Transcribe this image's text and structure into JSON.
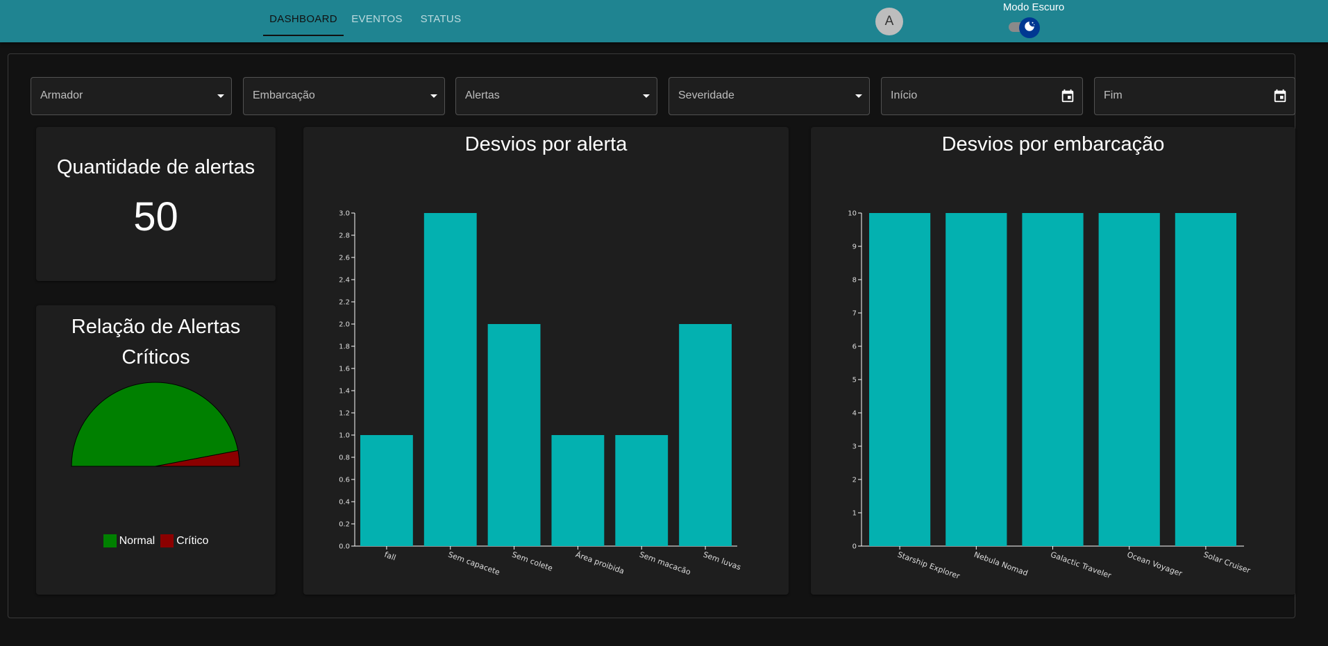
{
  "header": {
    "tabs": [
      {
        "label": "DASHBOARD",
        "active": true
      },
      {
        "label": "EVENTOS",
        "active": false
      },
      {
        "label": "STATUS",
        "active": false
      }
    ],
    "avatar_initial": "A",
    "dark_mode_label": "Modo Escuro",
    "dark_mode_on": true,
    "accent_color": "#1f8491"
  },
  "filters": [
    {
      "label": "Armador",
      "icon": "caret-down-icon"
    },
    {
      "label": "Embarcação",
      "icon": "caret-down-icon"
    },
    {
      "label": "Alertas",
      "icon": "caret-down-icon"
    },
    {
      "label": "Severidade",
      "icon": "caret-down-icon"
    },
    {
      "label": "Início",
      "icon": "calendar-icon"
    },
    {
      "label": "Fim",
      "icon": "calendar-icon"
    }
  ],
  "alert_count": {
    "title": "Quantidade de alertas",
    "value": "50"
  },
  "critical": {
    "title_line1": "Relação de Alertas",
    "title_line2": "Críticos",
    "legend": [
      {
        "label": "Normal",
        "color": "#008000"
      },
      {
        "label": "Crítico",
        "color": "#8b0000"
      }
    ]
  },
  "chart_data": [
    {
      "type": "pie",
      "variant": "semicircle",
      "categories": [
        "Normal",
        "Crítico"
      ],
      "values": [
        47,
        3
      ],
      "colors": [
        "#008000",
        "#8b0000"
      ]
    },
    {
      "type": "bar",
      "title": "Desvios por alerta",
      "categories": [
        "fall",
        "Sem capacete",
        "Sem colete",
        "Área proibida",
        "Sem macacão",
        "Sem luvas"
      ],
      "values": [
        1,
        3,
        2,
        1,
        1,
        2
      ],
      "ylim": [
        0,
        3
      ],
      "yticks": [
        "0.0",
        "0.2",
        "0.4",
        "0.6",
        "0.8",
        "1.0",
        "1.2",
        "1.4",
        "1.6",
        "1.8",
        "2.0",
        "2.2",
        "2.4",
        "2.6",
        "2.8",
        "3.0"
      ],
      "color": "#03b1b0"
    },
    {
      "type": "bar",
      "title": "Desvios por embarcação",
      "categories": [
        "Starship Explorer",
        "Nebula Nomad",
        "Galactic Traveler",
        "Ocean Voyager",
        "Solar Cruiser"
      ],
      "values": [
        10,
        10,
        10,
        10,
        10
      ],
      "ylim": [
        0,
        10
      ],
      "yticks": [
        "0",
        "1",
        "2",
        "3",
        "4",
        "5",
        "6",
        "7",
        "8",
        "9",
        "10"
      ],
      "color": "#03b1b0"
    }
  ]
}
